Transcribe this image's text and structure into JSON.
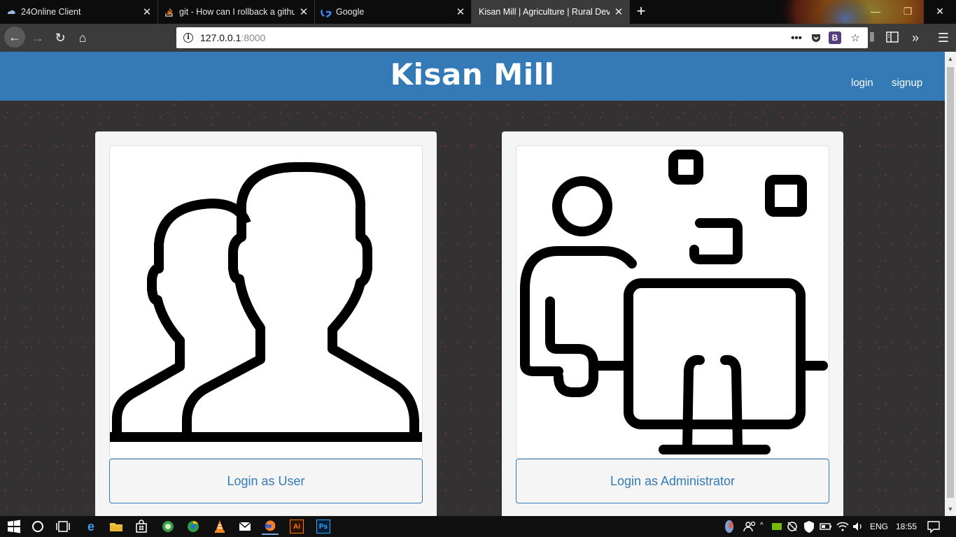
{
  "browser": {
    "tabs": [
      {
        "title": "24Online Client",
        "icon": "cloud-icon"
      },
      {
        "title": "git - How can I rollback a github",
        "icon": "stackoverflow-icon"
      },
      {
        "title": "Google",
        "icon": "google-icon"
      },
      {
        "title": "Kisan Mill | Agriculture | Rural Deve",
        "icon": "none",
        "active": true
      }
    ],
    "new_tab_label": "+",
    "url_host": "127.0.0.1",
    "url_port": ":8000",
    "extension_badge": "B",
    "colors": {
      "tabbar": "#0c0c0c",
      "navbar": "#3b3b3b"
    }
  },
  "site": {
    "brand": "Kisan Mill",
    "nav": {
      "login": "login",
      "signup": "signup"
    },
    "colors": {
      "primary": "#337ab7",
      "card": "#f5f5f5"
    },
    "cards": [
      {
        "button_label": "Login as User",
        "image": "two-users-icon"
      },
      {
        "button_label": "Login as Administrator",
        "image": "admin-computer-icon"
      }
    ]
  },
  "taskbar": {
    "language": "ENG",
    "time": "18:55",
    "pinned": [
      "windows-start-icon",
      "cortana-icon",
      "task-view-icon",
      "edge-icon",
      "file-explorer-icon",
      "store-icon",
      "app-icon",
      "chrome-like-icon",
      "vlc-icon",
      "mail-icon",
      "firefox-icon",
      "illustrator-icon",
      "photoshop-icon"
    ],
    "illustrator_label": "Ai",
    "photoshop_label": "Ps"
  }
}
